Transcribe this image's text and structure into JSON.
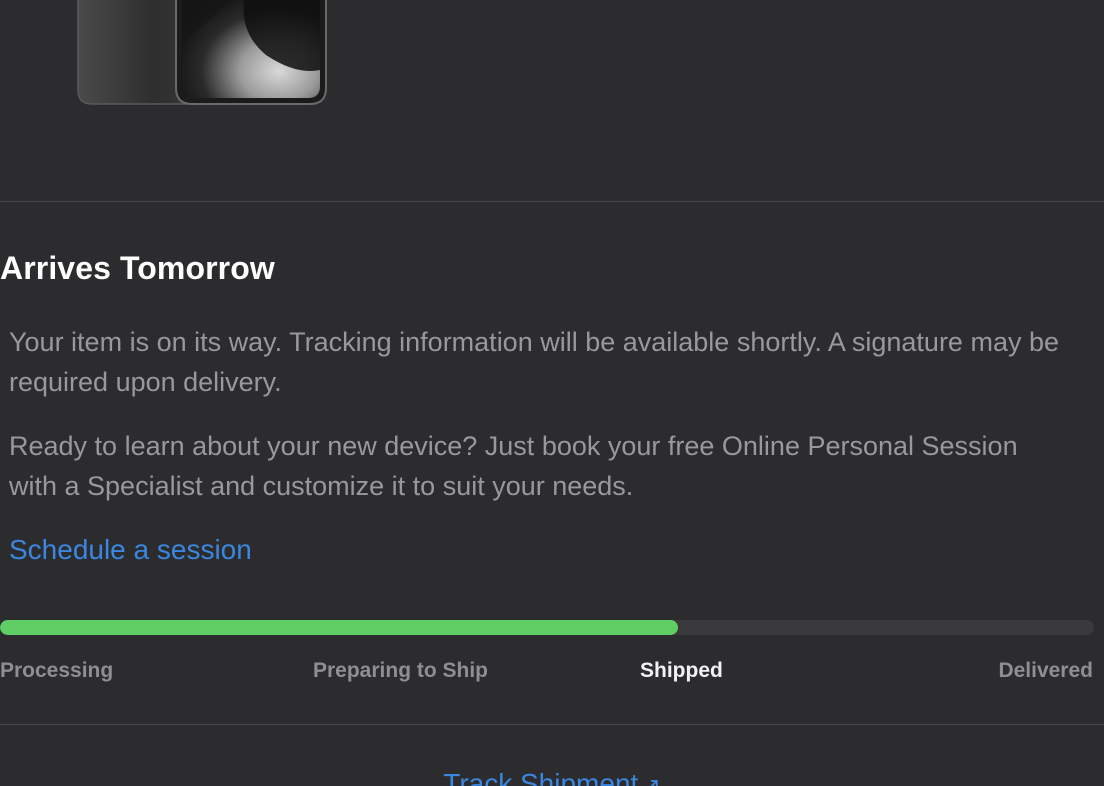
{
  "colors": {
    "background": "#2c2c2e",
    "progress_fill": "#5fcf65",
    "progress_track": "#3a3a3c",
    "link": "#3a86e0",
    "heading": "#ffffff",
    "body_text": "#98989d"
  },
  "product": {
    "image_icon": "iphone-image"
  },
  "status": {
    "heading": "Arrives Tomorrow",
    "message": "Your item is on its way. Tracking information will be available shortly. A signature may be required upon delivery.",
    "promo": "Ready to learn about your new device? Just book your free Online Personal Session with a Specialist and customize it to suit your needs.",
    "schedule_link": "Schedule a session"
  },
  "progress": {
    "fraction": 0.62,
    "steps": [
      {
        "label": "Processing"
      },
      {
        "label": "Preparing to Ship"
      },
      {
        "label": "Shipped",
        "active": true
      },
      {
        "label": "Delivered"
      }
    ]
  },
  "track": {
    "label": "Track Shipment",
    "icon": "external-arrow-icon",
    "arrow_glyph": "↗"
  }
}
